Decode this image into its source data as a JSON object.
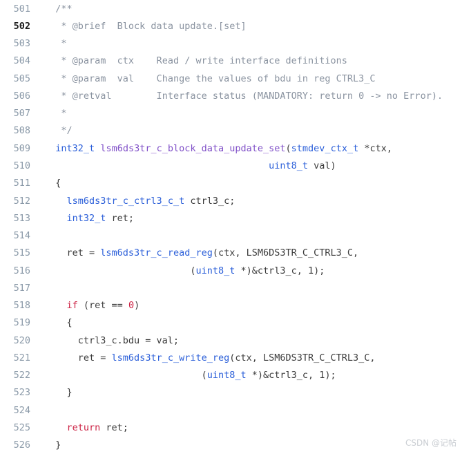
{
  "editor": {
    "background_color": "#ffffff",
    "text_color": "#3b3b3b",
    "line_number_color": "#8a99a8",
    "current_line_number": 502,
    "first_line_number": 501,
    "last_line_number": 526
  },
  "syntax_colors": {
    "comment": "#8a93a0",
    "type": "#2b5fd9",
    "function_definition": "#8050c8",
    "function_call": "#2b5fd9",
    "keyword": "#cc2244",
    "number": "#cc2244",
    "plain": "#3b3b3b"
  },
  "watermark": {
    "text": "CSDN @记帖",
    "color": "#c9cdd2"
  },
  "lines": [
    {
      "number": "501",
      "current": false,
      "tokens": [
        {
          "t": "  ",
          "c": "plain"
        },
        {
          "t": "/**",
          "c": "comment"
        }
      ]
    },
    {
      "number": "502",
      "current": true,
      "tokens": [
        {
          "t": "   ",
          "c": "plain"
        },
        {
          "t": "* @brief  Block data update.[set]",
          "c": "comment"
        }
      ]
    },
    {
      "number": "503",
      "current": false,
      "tokens": [
        {
          "t": "   ",
          "c": "plain"
        },
        {
          "t": "*",
          "c": "comment"
        }
      ]
    },
    {
      "number": "504",
      "current": false,
      "tokens": [
        {
          "t": "   ",
          "c": "plain"
        },
        {
          "t": "* @param  ctx    Read / write interface definitions",
          "c": "comment"
        }
      ]
    },
    {
      "number": "505",
      "current": false,
      "tokens": [
        {
          "t": "   ",
          "c": "plain"
        },
        {
          "t": "* @param  val    Change the values of bdu in reg CTRL3_C",
          "c": "comment"
        }
      ]
    },
    {
      "number": "506",
      "current": false,
      "tokens": [
        {
          "t": "   ",
          "c": "plain"
        },
        {
          "t": "* @retval        Interface status (MANDATORY: return 0 -> no Error).",
          "c": "comment"
        }
      ]
    },
    {
      "number": "507",
      "current": false,
      "tokens": [
        {
          "t": "   ",
          "c": "plain"
        },
        {
          "t": "*",
          "c": "comment"
        }
      ]
    },
    {
      "number": "508",
      "current": false,
      "tokens": [
        {
          "t": "   ",
          "c": "plain"
        },
        {
          "t": "*/",
          "c": "comment"
        }
      ]
    },
    {
      "number": "509",
      "current": false,
      "tokens": [
        {
          "t": "  ",
          "c": "plain"
        },
        {
          "t": "int32_t",
          "c": "type"
        },
        {
          "t": " ",
          "c": "plain"
        },
        {
          "t": "lsm6ds3tr_c_block_data_update_set",
          "c": "funcdef"
        },
        {
          "t": "(",
          "c": "plain"
        },
        {
          "t": "stmdev_ctx_t",
          "c": "type"
        },
        {
          "t": " *ctx,",
          "c": "plain"
        }
      ]
    },
    {
      "number": "510",
      "current": false,
      "tokens": [
        {
          "t": "                                        ",
          "c": "plain"
        },
        {
          "t": "uint8_t",
          "c": "type"
        },
        {
          "t": " val)",
          "c": "plain"
        }
      ]
    },
    {
      "number": "511",
      "current": false,
      "tokens": [
        {
          "t": "  {",
          "c": "plain"
        }
      ]
    },
    {
      "number": "512",
      "current": false,
      "tokens": [
        {
          "t": "    ",
          "c": "plain"
        },
        {
          "t": "lsm6ds3tr_c_ctrl3_c_t",
          "c": "type"
        },
        {
          "t": " ctrl3_c;",
          "c": "plain"
        }
      ]
    },
    {
      "number": "513",
      "current": false,
      "tokens": [
        {
          "t": "    ",
          "c": "plain"
        },
        {
          "t": "int32_t",
          "c": "type"
        },
        {
          "t": " ret;",
          "c": "plain"
        }
      ]
    },
    {
      "number": "514",
      "current": false,
      "tokens": []
    },
    {
      "number": "515",
      "current": false,
      "tokens": [
        {
          "t": "    ret = ",
          "c": "plain"
        },
        {
          "t": "lsm6ds3tr_c_read_reg",
          "c": "funccall"
        },
        {
          "t": "(ctx, LSM6DS3TR_C_CTRL3_C,",
          "c": "plain"
        }
      ]
    },
    {
      "number": "516",
      "current": false,
      "tokens": [
        {
          "t": "                          (",
          "c": "plain"
        },
        {
          "t": "uint8_t",
          "c": "type"
        },
        {
          "t": " *)&ctrl3_c, ",
          "c": "plain"
        },
        {
          "t": "1",
          "c": "plain"
        },
        {
          "t": ");",
          "c": "plain"
        }
      ]
    },
    {
      "number": "517",
      "current": false,
      "tokens": []
    },
    {
      "number": "518",
      "current": false,
      "tokens": [
        {
          "t": "    ",
          "c": "plain"
        },
        {
          "t": "if",
          "c": "keyword"
        },
        {
          "t": " (ret == ",
          "c": "plain"
        },
        {
          "t": "0",
          "c": "number"
        },
        {
          "t": ")",
          "c": "plain"
        }
      ]
    },
    {
      "number": "519",
      "current": false,
      "tokens": [
        {
          "t": "    {",
          "c": "plain"
        }
      ]
    },
    {
      "number": "520",
      "current": false,
      "tokens": [
        {
          "t": "      ctrl3_c.bdu = val;",
          "c": "plain"
        }
      ]
    },
    {
      "number": "521",
      "current": false,
      "tokens": [
        {
          "t": "      ret = ",
          "c": "plain"
        },
        {
          "t": "lsm6ds3tr_c_write_reg",
          "c": "funccall"
        },
        {
          "t": "(ctx, LSM6DS3TR_C_CTRL3_C,",
          "c": "plain"
        }
      ]
    },
    {
      "number": "522",
      "current": false,
      "tokens": [
        {
          "t": "                            (",
          "c": "plain"
        },
        {
          "t": "uint8_t",
          "c": "type"
        },
        {
          "t": " *)&ctrl3_c, ",
          "c": "plain"
        },
        {
          "t": "1",
          "c": "plain"
        },
        {
          "t": ");",
          "c": "plain"
        }
      ]
    },
    {
      "number": "523",
      "current": false,
      "tokens": [
        {
          "t": "    }",
          "c": "plain"
        }
      ]
    },
    {
      "number": "524",
      "current": false,
      "tokens": []
    },
    {
      "number": "525",
      "current": false,
      "tokens": [
        {
          "t": "    ",
          "c": "plain"
        },
        {
          "t": "return",
          "c": "keyword"
        },
        {
          "t": " ret;",
          "c": "plain"
        }
      ]
    },
    {
      "number": "526",
      "current": false,
      "tokens": [
        {
          "t": "  }",
          "c": "plain"
        }
      ]
    }
  ]
}
